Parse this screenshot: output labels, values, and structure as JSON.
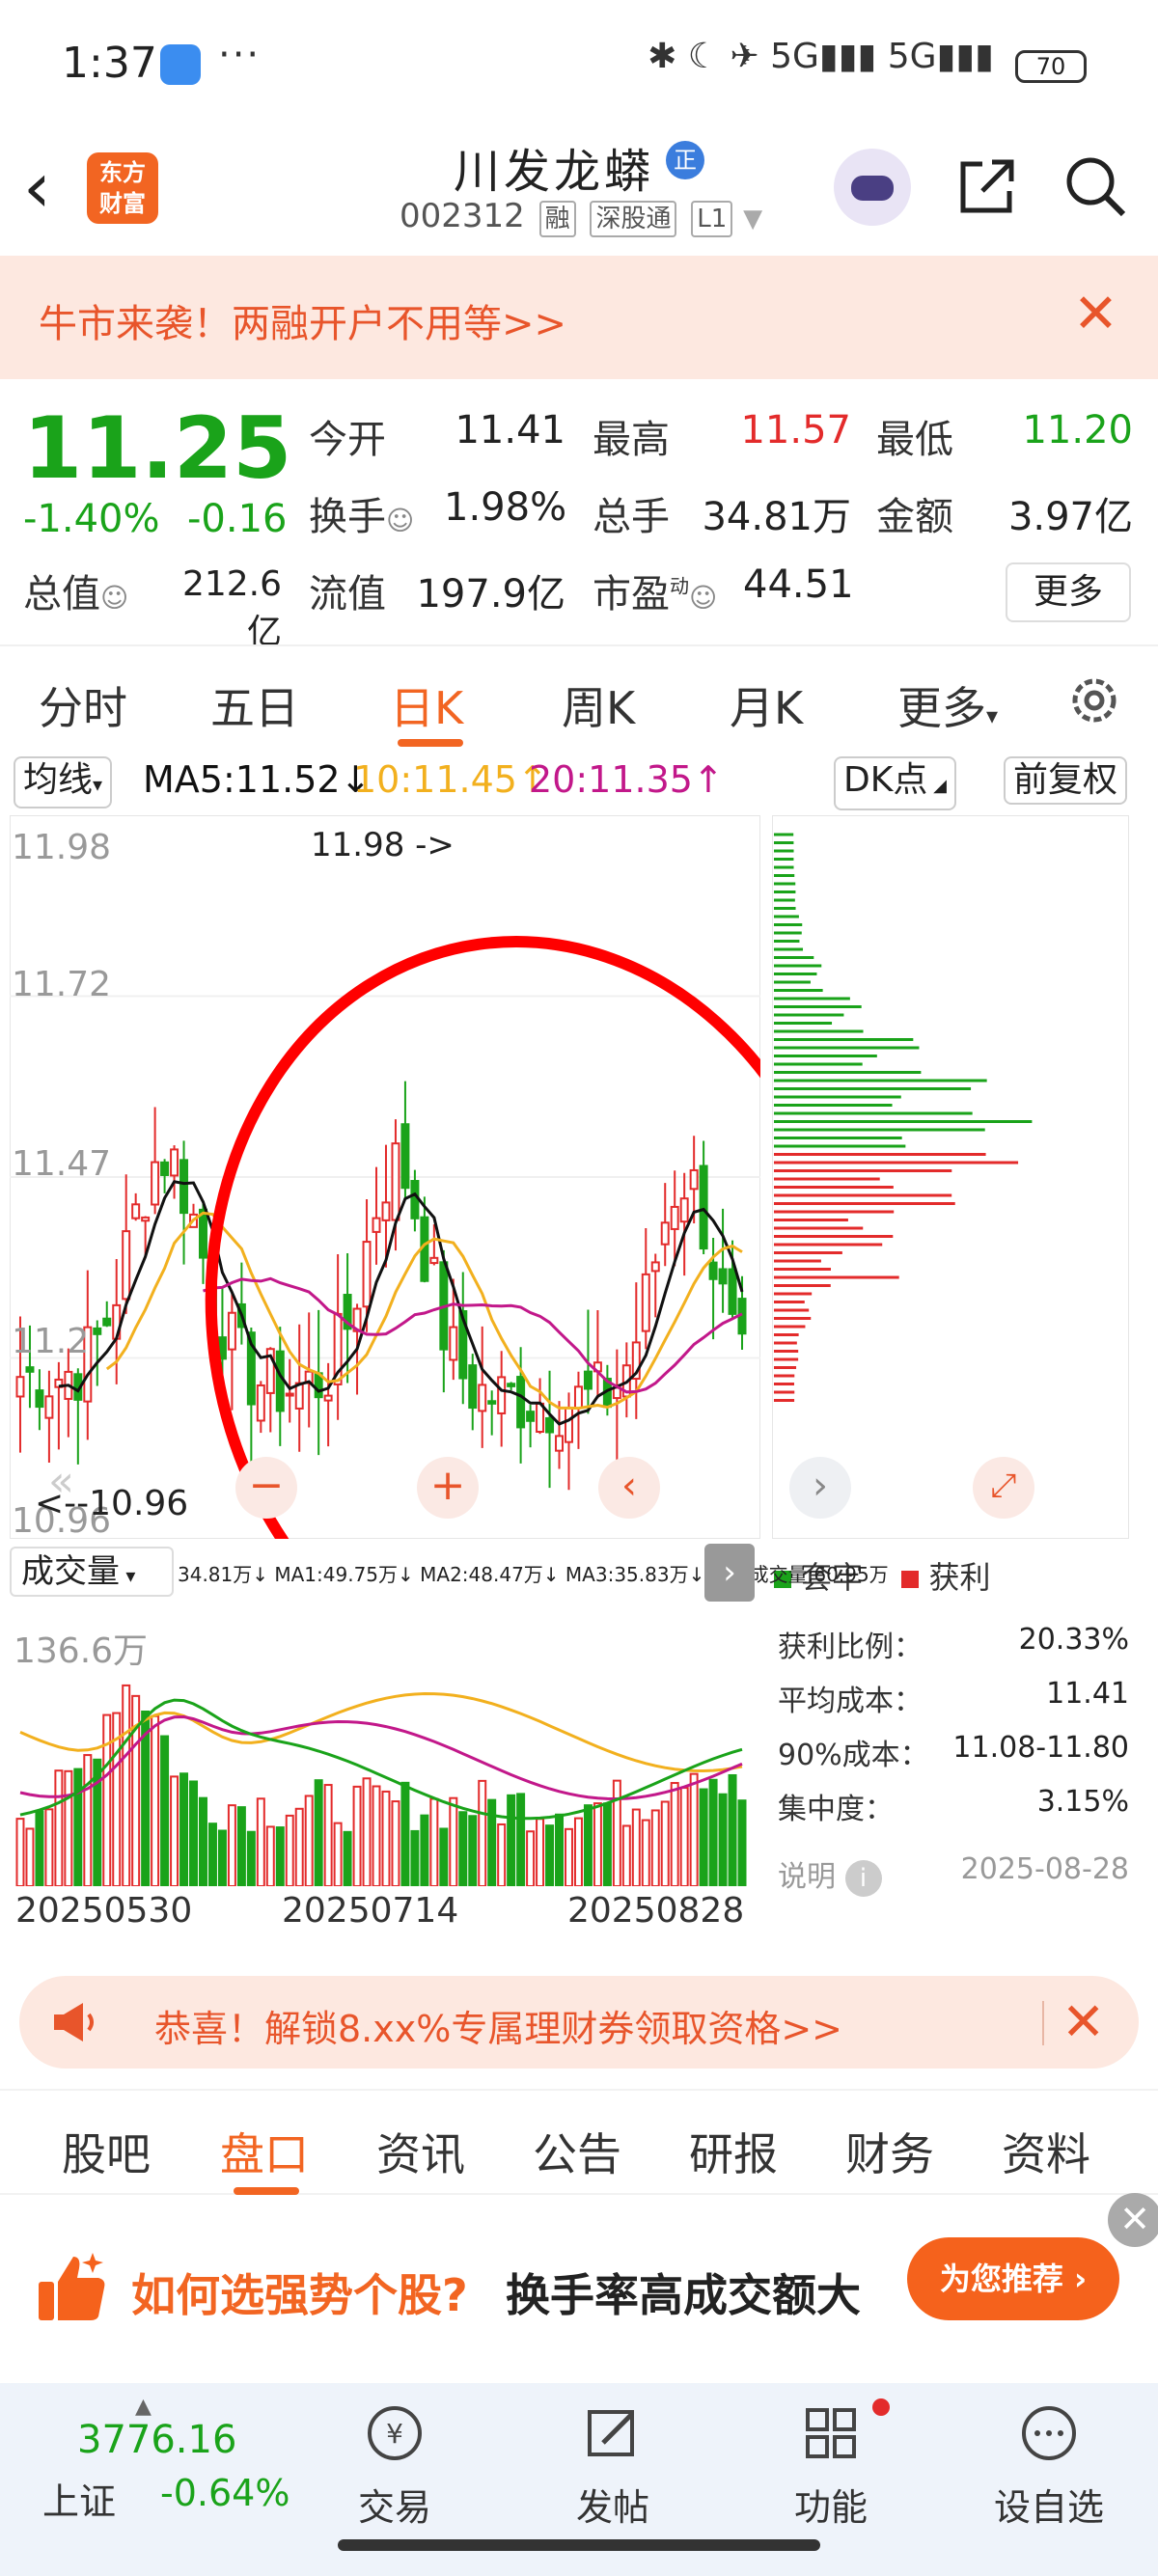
{
  "status_bar": {
    "time": "1:37",
    "more": "···",
    "signal_labels": "✱ ☾ ✈ 5G▮▮▮ 5G▮▮▮",
    "battery": "70"
  },
  "header": {
    "stock_name": "川发龙蟒",
    "badge": "正",
    "stock_code": "002312",
    "tags": [
      "融",
      "深股通",
      "L1"
    ],
    "logo_line1": "东方",
    "logo_line2": "财富"
  },
  "promo_top": {
    "text": "牛市来袭！两融开户不用等>>"
  },
  "quote": {
    "price": "11.25",
    "change_pct": "-1.40%",
    "change_abs": "-0.16",
    "today_open_label": "今开",
    "today_open": "11.41",
    "high_label": "最高",
    "high": "11.57",
    "low_label": "最低",
    "low": "11.20",
    "turnover_label": "换手",
    "turnover": "1.98%",
    "volume_label": "总手",
    "volume": "34.81万",
    "amount_label": "金额",
    "amount": "3.97亿",
    "mktcap_label": "总值",
    "mktcap": "212.6亿",
    "float_label": "流值",
    "float_val": "197.9亿",
    "pe_label": "市盈",
    "pe_sup": "动",
    "pe": "44.51",
    "more": "更多"
  },
  "ktabs": [
    "分时",
    "五日",
    "日K",
    "周K",
    "月K",
    "更多"
  ],
  "mabar": {
    "avg_line": "均线",
    "ma5": "MA5:11.52↓",
    "ma10": "10:11.45↑",
    "ma20": "20:11.35↑",
    "dk": "DK点",
    "fq": "前复权"
  },
  "price_axis": [
    "11.98",
    "11.72",
    "11.47",
    "11.2",
    "10.96"
  ],
  "price_annotations": {
    "high": "11.98 ->",
    "low": "<--10.96"
  },
  "volume": {
    "label": "成交量",
    "line": "34.81万↓  MA1:49.75万↓  MA2:48.47万↓  MA3:35.83万↓  虚拟成交量:60.95万",
    "axis_max": "136.6万"
  },
  "dates": [
    "20250530",
    "20250714",
    "20250828"
  ],
  "chips": {
    "legend_trapped": "套牢",
    "legend_profit": "获利",
    "rows": [
      {
        "label": "获利比例：",
        "value": "20.33%"
      },
      {
        "label": "平均成本：",
        "value": "11.41"
      },
      {
        "label": "90%成本：",
        "value": "11.08-11.80"
      },
      {
        "label": "集中度：",
        "value": "3.15%"
      }
    ],
    "note_label": "说明",
    "note_date": "2025-08-28"
  },
  "promo_mid": {
    "text": "恭喜！解锁8.xx%专属理财券领取资格>>"
  },
  "btabs": [
    "股吧",
    "盘口",
    "资讯",
    "公告",
    "研报",
    "财务",
    "资料"
  ],
  "ad": {
    "question": "如何选强势个股?",
    "tagline": "换手率高成交额大",
    "button": "为您推荐 ›"
  },
  "nav": {
    "index_value": "3776.16",
    "index_name": "上证",
    "index_change": "-0.64%",
    "items": [
      "交易",
      "发帖",
      "功能",
      "设自选"
    ]
  },
  "colors": {
    "accent": "#f26522",
    "up": "#e32b2b",
    "down": "#1aa31a",
    "ma5": "#111111",
    "ma10": "#f2b01e",
    "ma20": "#c2188a"
  },
  "chart_data": {
    "type": "candlestick",
    "title": "",
    "ylim": [
      10.96,
      11.98
    ],
    "dates_shown": [
      "20250530",
      "20250714",
      "20250828"
    ],
    "ohlc_summary": {
      "open": 11.41,
      "high": 11.57,
      "low": 11.2,
      "close": 11.25
    },
    "period_high": 11.98,
    "period_low": 10.96,
    "series": [
      {
        "name": "MA5",
        "last": 11.52
      },
      {
        "name": "10",
        "last": 11.45
      },
      {
        "name": "20",
        "last": 11.35
      }
    ]
  }
}
